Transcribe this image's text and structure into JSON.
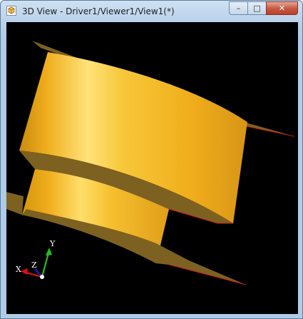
{
  "window": {
    "title": "3D View - Driver1/Viewer1/View1(*)",
    "icon": "3d-view-app-icon",
    "controls": {
      "minimize_label": "–",
      "maximize_label": "□",
      "close_label": "✕"
    }
  },
  "viewport": {
    "background": "#000000",
    "model_color": "#f0b21e",
    "edge_color": "#c8101a",
    "axes": {
      "x_label": "X",
      "y_label": "Y",
      "z_label": "Z",
      "x_color": "#e01010",
      "y_color": "#20c020",
      "z_color": "#1a1aa0"
    }
  }
}
